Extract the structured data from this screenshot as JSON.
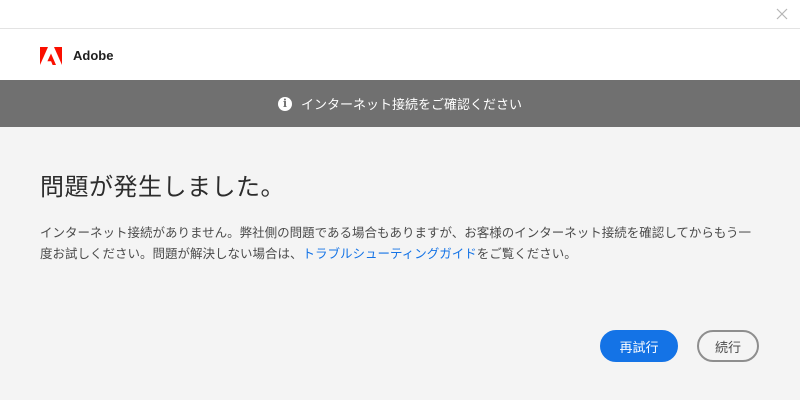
{
  "window": {
    "close_icon": "close-icon"
  },
  "header": {
    "logo_icon": "adobe-logo-icon",
    "brand": "Adobe",
    "brand_color": "#fa0f00"
  },
  "banner": {
    "icon": "info-icon",
    "message": "インターネット接続をご確認ください"
  },
  "dialog": {
    "title": "問題が発生しました。",
    "body_before_link": "インターネット接続がありません。弊社側の問題である場合もありますが、お客様のインターネット接続を確認してからもう一度お試しください。問題が解決しない場合は、",
    "link_label": "トラブルシューティングガイド",
    "body_after_link": "をご覧ください。"
  },
  "buttons": {
    "retry_label": "再試行",
    "continue_label": "続行"
  },
  "colors": {
    "accent": "#1473e6",
    "banner_bg": "#707070",
    "page_bg": "#f4f4f4"
  }
}
